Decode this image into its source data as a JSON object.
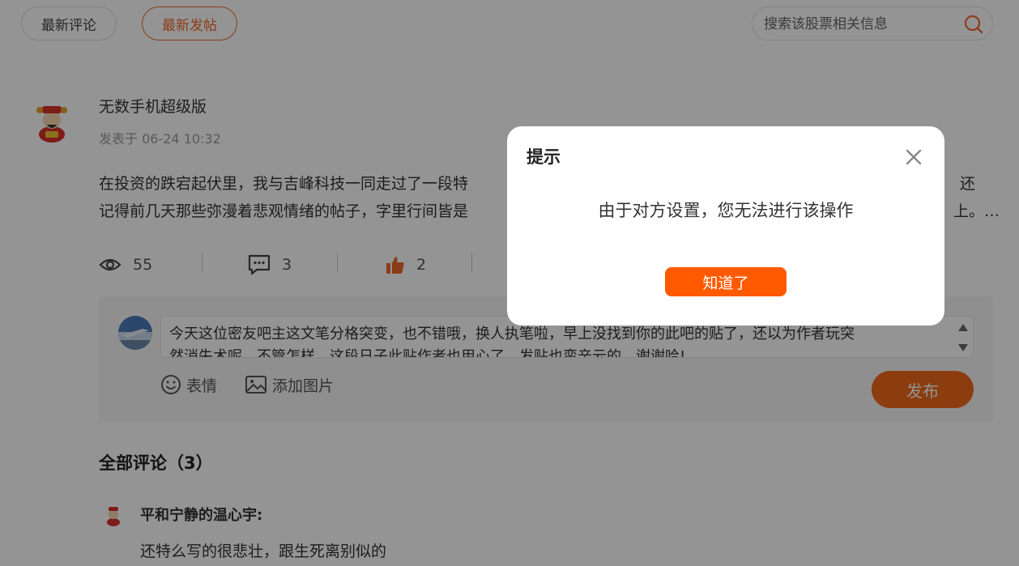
{
  "tabs": {
    "latest_comments": "最新评论",
    "latest_posts": "最新发帖"
  },
  "search": {
    "placeholder": "搜索该股票相关信息",
    "icon": "search-icon"
  },
  "post": {
    "author": "无数手机超级版",
    "time": "发表于 06-24 10:32",
    "body_line1": "在投资的跌宕起伏里，我与吉峰科技一同走过了一段特",
    "body_line1_tail": "还",
    "body_line2": "记得前几天那些弥漫着悲观情绪的帖子，字里行间皆是",
    "body_line2_tail": "上。…",
    "views": "55",
    "comments": "3",
    "likes": "2"
  },
  "reply": {
    "text_line1": "今天这位密友吧主这文笔分格突变，也不错哦，换人执笔啦，早上没找到你的此吧的贴了，还以为作者玩突",
    "text_line2": "然消失术呢，不管怎样，这段日子此贴作者也用心了，发贴也蛮辛云的，谢谢哈!",
    "emoji_label": "表情",
    "image_label": "添加图片",
    "publish_label": "发布"
  },
  "comments_section": {
    "title": "全部评论（3）",
    "items": [
      {
        "author": "平和宁静的温心宇:",
        "text": "还特么写的很悲壮，跟生死离别似的"
      }
    ]
  },
  "modal": {
    "title": "提示",
    "message": "由于对方设置，您无法进行该操作",
    "ok_label": "知道了"
  },
  "colors": {
    "accent": "#f06a2a",
    "modal_button": "#ff5a00",
    "overlay": "rgba(0,0,0,0.42)"
  }
}
